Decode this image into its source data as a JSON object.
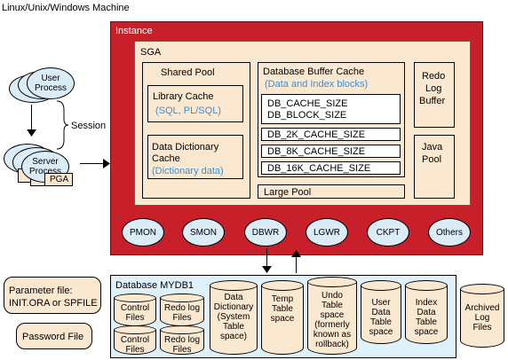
{
  "machine_label": "Linux/Unix/Windows Machine",
  "instance": {
    "title": "Instance",
    "sga": {
      "title": "SGA",
      "shared_pool": {
        "title": "Shared Pool",
        "library_cache": "Library Cache",
        "library_cache_note": "(SQL, PL/SQL)",
        "data_dictionary_cache_line1": "Data Dictionary",
        "data_dictionary_cache_line2": "Cache",
        "data_dictionary_note": "(Dictionary data)"
      },
      "db_buffer_cache": {
        "title": "Database Buffer Cache",
        "note": "(Data and Index blocks)",
        "cache_size": "DB_CACHE_SIZE",
        "block_size": "DB_BLOCK_SIZE",
        "k2": "DB_2K_CACHE_SIZE",
        "k8": "DB_8K_CACHE_SIZE",
        "k16": "DB_16K_CACHE_SIZE"
      },
      "large_pool": "Large Pool",
      "redo_log_buffer": [
        "Redo",
        "Log",
        "Buffer"
      ],
      "java_pool": [
        "Java",
        "Pool"
      ]
    },
    "processes": [
      "PMON",
      "SMON",
      "DBWR",
      "LGWR",
      "CKPT",
      "Others"
    ]
  },
  "client": {
    "user_process": [
      "User",
      "Process"
    ],
    "server_process": [
      "Server",
      "Process"
    ],
    "session": "Session",
    "pga": "PGA"
  },
  "files": {
    "parameter_file": [
      "Parameter file:",
      "INIT.ORA or SPFILE"
    ],
    "password_file": "Password File",
    "archived_logs": "Archived\nLog\nFiles"
  },
  "database": {
    "title": "Database MYDB1",
    "control_files_1": "Control\nFiles",
    "redo_log_files_1": "Redo log\nFiles",
    "control_files_2": "Control\nFiles",
    "redo_log_files_2": "Redo log\nFiles",
    "data_dictionary": "Data\nDictionary\n(System\nTable\nspace)",
    "temp_tablespace": "Temp\nTable\nspace",
    "undo_tablespace": "Undo\nTable\nspace\n(formerly\nknown as\nrollback)",
    "user_data": "User\nData\nTable\nspace",
    "index_data": "Index\nData\nTable\nspace"
  }
}
